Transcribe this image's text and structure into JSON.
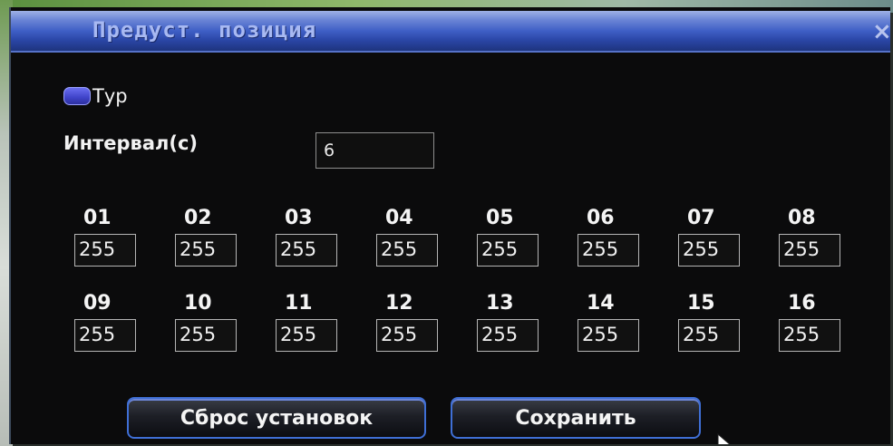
{
  "dialog": {
    "title": "Предуст. позиция",
    "close_glyph": "×"
  },
  "tour": {
    "label": "Тур",
    "checked": true
  },
  "interval": {
    "label": "Интервал(с)",
    "value": "6"
  },
  "presets": [
    {
      "num": "01",
      "value": "255"
    },
    {
      "num": "02",
      "value": "255"
    },
    {
      "num": "03",
      "value": "255"
    },
    {
      "num": "04",
      "value": "255"
    },
    {
      "num": "05",
      "value": "255"
    },
    {
      "num": "06",
      "value": "255"
    },
    {
      "num": "07",
      "value": "255"
    },
    {
      "num": "08",
      "value": "255"
    },
    {
      "num": "09",
      "value": "255"
    },
    {
      "num": "10",
      "value": "255"
    },
    {
      "num": "11",
      "value": "255"
    },
    {
      "num": "12",
      "value": "255"
    },
    {
      "num": "13",
      "value": "255"
    },
    {
      "num": "14",
      "value": "255"
    },
    {
      "num": "15",
      "value": "255"
    },
    {
      "num": "16",
      "value": "255"
    }
  ],
  "buttons": {
    "reset_label": "Сброс установок",
    "save_label": "Сохранить"
  },
  "colors": {
    "titlebar_blue": "#3f5fc6",
    "checkbox_blue": "#4a4ed8",
    "button_border": "#3f6fd6"
  }
}
